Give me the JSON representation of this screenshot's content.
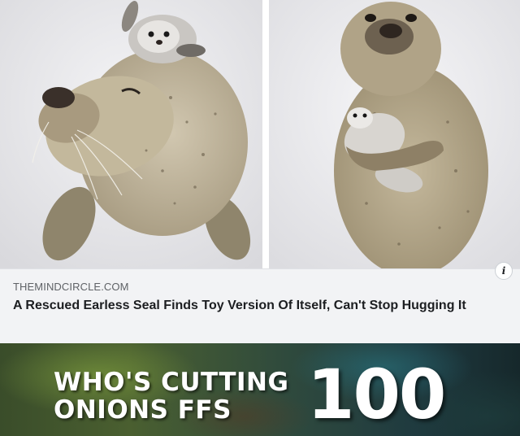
{
  "post": {
    "site": "THEMINDCIRCLE.COM",
    "headline": "A Rescued Earless Seal Finds Toy Version Of Itself, Can't Stop Hugging It",
    "info_icon": "i"
  },
  "meme": {
    "line1": "WHO'S CUTTING",
    "line2": "ONIONS FFS",
    "emoji_text": "100"
  }
}
